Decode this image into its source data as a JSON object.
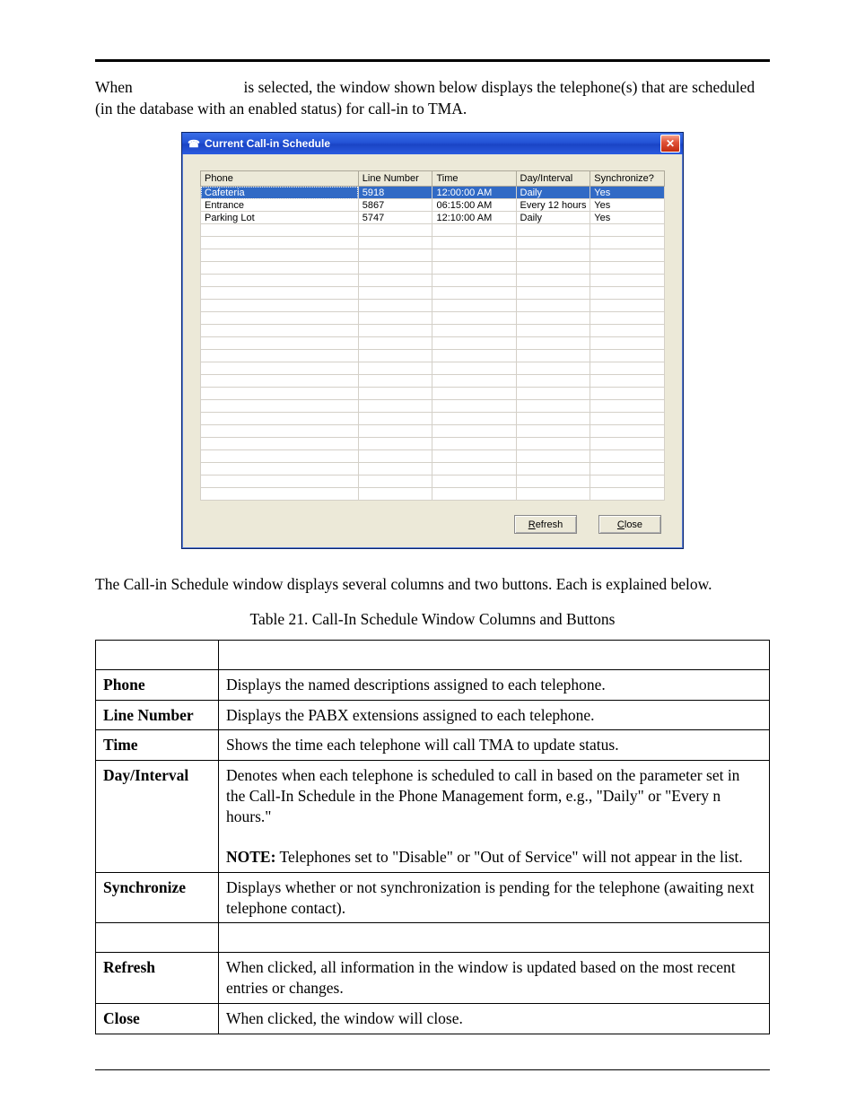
{
  "intro": {
    "pre": "When ",
    "post": " is selected, the window shown below displays the telephone(s) that are scheduled (in the database with an enabled status) for call-in to TMA."
  },
  "dialog": {
    "title": "Current Call-in Schedule",
    "columns": {
      "phone": "Phone",
      "line": "Line Number",
      "time": "Time",
      "day": "Day/Interval",
      "sync": "Synchronize?"
    },
    "rows": [
      {
        "phone": "Cafeteria",
        "line": "5918",
        "time": "12:00:00 AM",
        "day": "Daily",
        "sync": "Yes",
        "selected": true
      },
      {
        "phone": "Entrance",
        "line": "5867",
        "time": "06:15:00 AM",
        "day": "Every 12 hours",
        "sync": "Yes"
      },
      {
        "phone": "Parking Lot",
        "line": "5747",
        "time": "12:10:00 AM",
        "day": "Daily",
        "sync": "Yes"
      }
    ],
    "empty_rows": 22,
    "buttons": {
      "refresh": "Refresh",
      "close": "Close"
    }
  },
  "after_screenshot": "The Call-in Schedule window displays several columns and two buttons.  Each is explained below.",
  "table_caption": "Table 21.  Call-In Schedule Window Columns and Buttons",
  "desc_table": {
    "rows": [
      {
        "label": "Phone",
        "text": "Displays the named descriptions assigned to each telephone."
      },
      {
        "label": "Line Number",
        "text": "Displays the PABX extensions assigned to each telephone."
      },
      {
        "label": "Time",
        "text": "Shows the time each telephone will call TMA to update status."
      },
      {
        "label": "Day/Interval",
        "text": "Denotes when each telephone is scheduled to call in based on the parameter set in the Call-In Schedule in the Phone Management form, e.g., \"Daily\" or \"Every n hours.\"",
        "note_label": "NOTE:",
        "note": "  Telephones set to \"Disable\" or \"Out of Service\" will not appear in the list."
      },
      {
        "label": "Synchronize",
        "text": "Displays whether or not synchronization is pending for the telephone (awaiting next telephone contact)."
      }
    ],
    "buttons_rows": [
      {
        "label": "Refresh",
        "text": "When clicked, all information in the window is updated based on the most recent entries or changes."
      },
      {
        "label": "Close",
        "text": "When clicked, the window will close."
      }
    ]
  }
}
